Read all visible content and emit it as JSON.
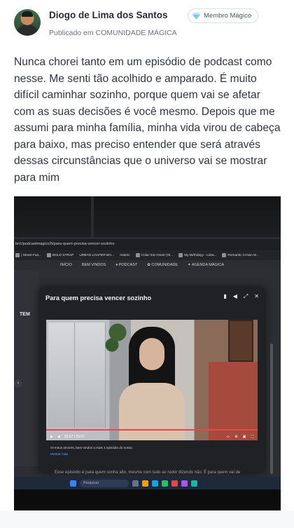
{
  "author": {
    "name": "Diogo de Lima dos Santos",
    "badge": "Membro Mágico",
    "subline": "Publicado em COMUNIDADE MÁGICA"
  },
  "post": {
    "text": "Nunca chorei tanto em um episódio de podcast como nesse. Me senti tão acolhido e amparado. É muito difícil caminhar sozinho, porque quem vai se afetar com as suas decisões é você mesmo. Depois que me assumi para minha família, minha vida virou de cabeça para baixo, mas preciso entender que será através dessas circunstâncias que o universo vai se mostrar para mim"
  },
  "photo": {
    "url": "br/c/podcastmagico2t/para-quem-precisa-vencer-sozinho",
    "bookmarks": [
      "| Street-Fas...",
      "BOLD STRAP",
      "URBAN LOAFER BO...",
      "Asteric",
      "Colar Iron Heart (Hi...",
      "My Birthdayy - Lista...",
      "Romantic Crown M..."
    ],
    "site_nav": [
      "INÍCIO",
      "BEM VINDOS",
      "♦ PODCAST",
      "✿ COMUNIDADE",
      "✦ AGENDA MÁGICA"
    ],
    "side_label": "TEM",
    "modal_title": "Para quem precisa vencer sozinho",
    "time": "25:07 / 25:07",
    "progress": 1.0,
    "caption": "Oi meus amores, bem-vindos a mais 1 episódio do nosso",
    "caption_more": "Mostrar mais",
    "bg_text": "Esse episódio é para quem sonha alto, mesmo com tudo ao redor dizendo não. É para quem vai de",
    "taskbar_search": "Pesquisar"
  },
  "colors": {
    "accent_red": "#ef4444",
    "badge_gem": "#60a5fa"
  }
}
